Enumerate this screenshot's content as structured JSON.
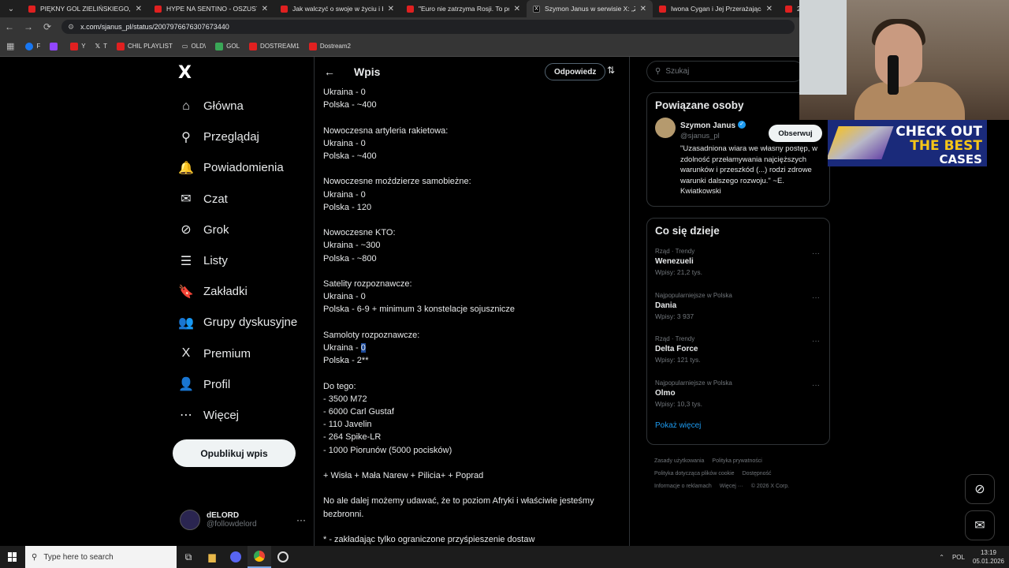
{
  "browser": {
    "tabs": [
      {
        "title": "PIĘKNY GOL ZIELIŃSKIEGO, FO",
        "icon": "youtube-icon"
      },
      {
        "title": "HYPE NA SENTINO - OSZUSTW",
        "icon": "youtube-icon"
      },
      {
        "title": "Jak walczyć o swoje w życiu i bi",
        "icon": "youtube-icon"
      },
      {
        "title": "\"Euro nie zatrzyma Rosji. To po",
        "icon": "youtube-icon"
      },
      {
        "title": "Szymon Janus w serwisie X: „Z",
        "icon": "x-icon",
        "active": true
      },
      {
        "title": "Iwona Cygan i Jej Przerażająca",
        "icon": "youtube-icon"
      },
      {
        "title": "2 g",
        "icon": "youtube-icon"
      }
    ],
    "url": "x.com/sjanus_pl/status/2007976676307673440",
    "bookmarks": [
      {
        "label": "F"
      },
      {
        "label": "Y"
      },
      {
        "label": "T"
      },
      {
        "label": "CHIL PLAYLIST"
      },
      {
        "label": "OLD\\"
      },
      {
        "label": "GOL"
      },
      {
        "label": "DOSTREAM1"
      },
      {
        "label": "Dostream2"
      }
    ]
  },
  "sidebar": {
    "logo": "X",
    "items": [
      {
        "label": "Główna",
        "icon": "⌂"
      },
      {
        "label": "Przeglądaj",
        "icon": "⚲"
      },
      {
        "label": "Powiadomienia",
        "icon": "🔔"
      },
      {
        "label": "Czat",
        "icon": "✉"
      },
      {
        "label": "Grok",
        "icon": "⊘"
      },
      {
        "label": "Listy",
        "icon": "☰"
      },
      {
        "label": "Zakładki",
        "icon": "🔖"
      },
      {
        "label": "Grupy dyskusyjne",
        "icon": "👥"
      },
      {
        "label": "Premium",
        "icon": "X"
      },
      {
        "label": "Profil",
        "icon": "👤"
      },
      {
        "label": "Więcej",
        "icon": "⋯"
      }
    ],
    "post_button": "Opublikuj wpis",
    "account": {
      "name": "dELORD",
      "handle": "@followdelord"
    }
  },
  "post": {
    "header_title": "Wpis",
    "reply_button": "Odpowiedz",
    "blocks": [
      [
        "Ukraina - 0",
        "Polska - ~400"
      ],
      [
        "Nowoczesna artyleria rakietowa:",
        "Ukraina - 0",
        "Polska - ~400"
      ],
      [
        "Nowoczesne moździerze samobieżne:",
        "Ukraina - 0",
        "Polska - 120"
      ],
      [
        "Nowoczesne KTO:",
        "Ukraina - ~300",
        "Polska - ~800"
      ],
      [
        "Satelity rozpoznawcze:",
        "Ukraina - 0",
        "Polska - 6-9 + minimum 3 konstelacje sojusznicze"
      ],
      [
        "Samoloty rozpoznawcze:",
        "Ukraina - 0",
        "Polska - 2**"
      ],
      [
        "Do tego:",
        "- 3500 M72",
        "- 6000 Carl Gustaf",
        "- 110 Javelin",
        "- 264 Spike-LR",
        "- 1000 Piorunów (5000 pocisków)"
      ],
      [
        "+ Wisła + Mała Narew + Pilicia+ + Poprad"
      ],
      [
        "No ale dalej możemy udawać, że to poziom Afryki i właściwie jesteśmy bezbronni."
      ],
      [
        "* - zakładając tylko ograniczone przyśpieszenie dostaw"
      ]
    ]
  },
  "right": {
    "search_placeholder": "Szukaj",
    "related": {
      "title": "Powiązane osoby",
      "name": "Szymon Janus",
      "handle": "@sjanus_pl",
      "bio": "\"Uzasadniona wiara we własny postęp, w zdolność przełamywania najcięższych warunków i przeszkód (...) rodzi zdrowe warunki dalszego rozwoju.\" ~E. Kwiatkowski",
      "follow": "Obserwuj"
    },
    "trends": {
      "title": "Co się dzieje",
      "items": [
        {
          "meta": "Rząd · Trendy",
          "name": "Wenezueli",
          "posts": "Wpisy: 21,2 tys."
        },
        {
          "meta": "Najpopularniejsze w Polska",
          "name": "Dania",
          "posts": "Wpisy: 3 937"
        },
        {
          "meta": "Rząd · Trendy",
          "name": "Delta Force",
          "posts": "Wpisy: 121 tys."
        },
        {
          "meta": "Najpopularniejsze w Polska",
          "name": "Olmo",
          "posts": "Wpisy: 10,3 tys."
        }
      ],
      "show_more": "Pokaż więcej"
    },
    "footer": [
      "Zasady użytkowania",
      "Polityka prywatności",
      "Polityka dotycząca plików cookie",
      "Dostępność",
      "Informacje o reklamach",
      "Więcej ···",
      "© 2026 X Corp."
    ]
  },
  "ad": {
    "line1": "CHECK OUT",
    "line2": "THE BEST",
    "line3": "CASES"
  },
  "taskbar": {
    "search_placeholder": "Type here to search",
    "lang": "POL",
    "time": "13:19",
    "date": "05.01.2026"
  },
  "colors": {
    "accent": "#1d9bf0",
    "background": "#000000",
    "text": "#e7e9ea",
    "muted": "#71767b"
  }
}
